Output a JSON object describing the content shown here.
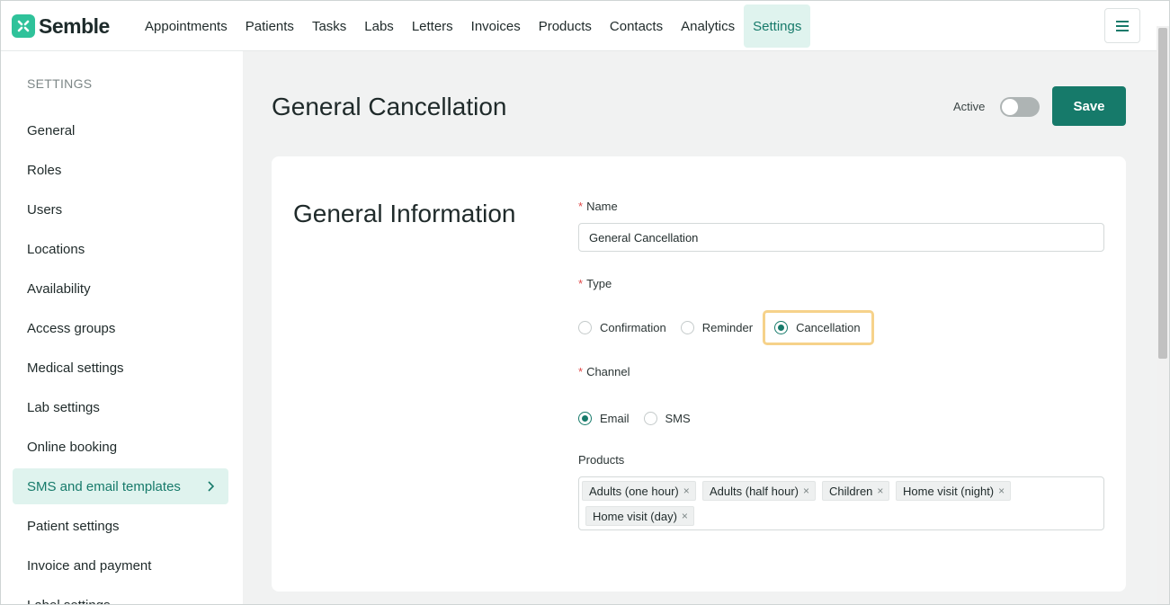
{
  "app": {
    "name": "Semble",
    "brand_color": "#2fc29a",
    "accent_color": "#167a6a"
  },
  "nav": {
    "items": [
      "Appointments",
      "Patients",
      "Tasks",
      "Labs",
      "Letters",
      "Invoices",
      "Products",
      "Contacts",
      "Analytics",
      "Settings"
    ],
    "active": "Settings",
    "menu_icon": "hamburger-icon"
  },
  "sidebar": {
    "heading": "SETTINGS",
    "items": [
      "General",
      "Roles",
      "Users",
      "Locations",
      "Availability",
      "Access groups",
      "Medical settings",
      "Lab settings",
      "Online booking",
      "SMS and email templates",
      "Patient settings",
      "Invoice and payment",
      "Label settings"
    ],
    "active": "SMS and email templates"
  },
  "header": {
    "title": "General Cancellation",
    "active_label": "Active",
    "active_on": false,
    "save_label": "Save"
  },
  "form": {
    "section_title": "General Information",
    "name": {
      "label": "Name",
      "required": "*",
      "value": "General Cancellation"
    },
    "type": {
      "label": "Type",
      "required": "*",
      "options": [
        "Confirmation",
        "Reminder",
        "Cancellation"
      ],
      "selected": "Cancellation"
    },
    "channel": {
      "label": "Channel",
      "required": "*",
      "options": [
        "Email",
        "SMS"
      ],
      "selected": "Email"
    },
    "products": {
      "label": "Products",
      "tags": [
        "Adults (one hour)",
        "Adults (half hour)",
        "Children",
        "Home visit (night)",
        "Home visit (day)"
      ],
      "remove_glyph": "×"
    }
  }
}
